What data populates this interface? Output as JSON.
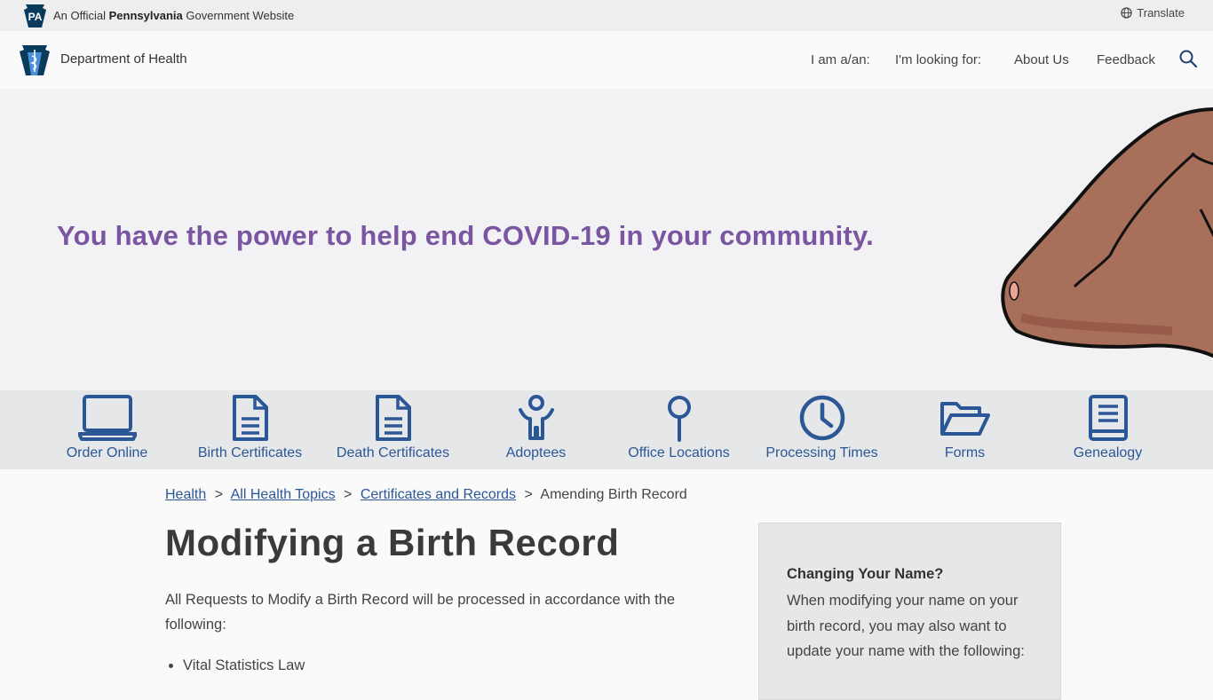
{
  "gov_bar": {
    "badge": "PA",
    "prefix": "An Official",
    "state": "Pennsylvania",
    "suffix": "Government Website",
    "translate_label": "Translate"
  },
  "header": {
    "department": "Department of Health",
    "nav": [
      {
        "label": "I am a/an:"
      },
      {
        "label": "I'm looking for:"
      },
      {
        "label": "About Us"
      },
      {
        "label": "Feedback"
      }
    ]
  },
  "hero": {
    "message": "You have the power to help end COVID-19 in your community."
  },
  "tiles": [
    {
      "label": "Order Online",
      "icon": "laptop-icon"
    },
    {
      "label": "Birth Certificates",
      "icon": "document-icon"
    },
    {
      "label": "Death Certificates",
      "icon": "document-icon"
    },
    {
      "label": "Adoptees",
      "icon": "person-icon"
    },
    {
      "label": "Office Locations",
      "icon": "map-pin-icon"
    },
    {
      "label": "Processing Times",
      "icon": "clock-icon"
    },
    {
      "label": "Forms",
      "icon": "folder-open-icon"
    },
    {
      "label": "Genealogy",
      "icon": "book-icon"
    }
  ],
  "breadcrumb": {
    "items": [
      {
        "label": "Health"
      },
      {
        "label": "All Health Topics"
      },
      {
        "label": "Certificates and Records"
      }
    ],
    "separator": ">",
    "current": "Amending Birth Record"
  },
  "main": {
    "title": "Modifying a Birth Record",
    "intro": "All Requests to Modify a Birth Record will be processed in accordance with the following:",
    "bullets": [
      "Vital Statistics Law"
    ]
  },
  "aside": {
    "title": "Changing Your Name?",
    "body": "When modifying your name on your birth record, you may also want to update your name with the following:"
  },
  "colors": {
    "brand_blue": "#2b5797",
    "hero_purple": "#7a55a2",
    "tile_bar": "#e6e7e9"
  }
}
